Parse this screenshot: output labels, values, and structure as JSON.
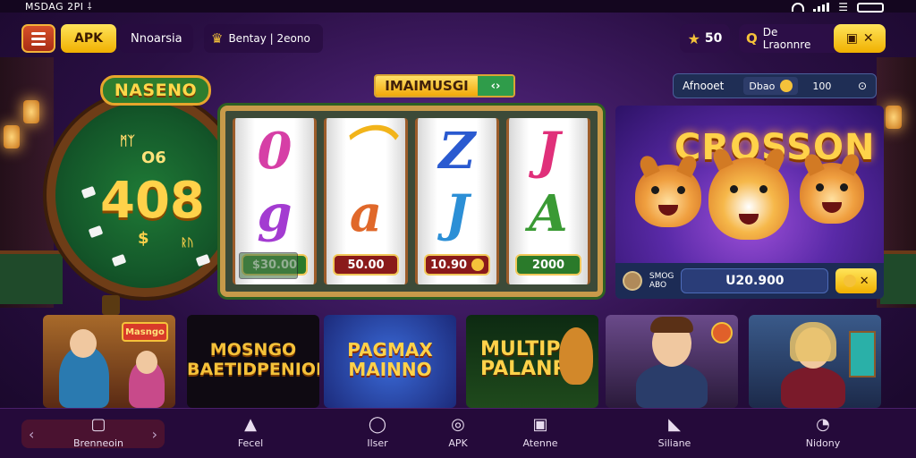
{
  "status_bar": {
    "time": "MSDAG 2PI ⸸"
  },
  "header": {
    "apk_label": "APK",
    "region_label": "Nnoarsia",
    "banner_label": "Bentay | 2eono",
    "stars_value": "50",
    "login_label": "De Lraonnre"
  },
  "wheel": {
    "sign": "NASENO",
    "code_top": "ᛗᛉ",
    "code_mid": "O6",
    "code_big": "408",
    "dollar": "$",
    "code_small": "ᚱᚢ"
  },
  "slot": {
    "header_label": "IMAIMUSGI",
    "toggle_label": "‹›",
    "reels": [
      {
        "top": "0",
        "bottom": "g",
        "top_color": "#d63fa6",
        "bottom_color": "#a33bd1",
        "payout": "$30.00",
        "payout_style": "green"
      },
      {
        "top": "⌒",
        "bottom": "a",
        "top_color": "#f2b41a",
        "bottom_color": "#e0682a",
        "payout": "50.00",
        "payout_style": "red"
      },
      {
        "top": "Z",
        "bottom": "J",
        "top_color": "#2a5ad0",
        "bottom_color": "#2c8fd6",
        "payout": "10.90",
        "payout_style": "red"
      },
      {
        "top": "J",
        "bottom": "A",
        "top_color": "#e0307a",
        "bottom_color": "#3a9a34",
        "payout": "2000",
        "payout_style": "green"
      }
    ]
  },
  "feature": {
    "bar_label": "Afnooet",
    "jackpot_label": "Dbao",
    "jackpot_amount": "100",
    "title": "CROSSON",
    "player_line1": "SMOG",
    "player_line2": "ABO",
    "amount": "U20.900"
  },
  "thumbnails": [
    {
      "title": "Masngo",
      "text": ""
    },
    {
      "title": "",
      "text": "MOSNGO BAETIDPENION"
    },
    {
      "title": "",
      "text": "PAGMAX MAINNO"
    },
    {
      "title": "",
      "text": "MULTIP PALANR"
    },
    {
      "title": "",
      "text": ""
    },
    {
      "title": "",
      "text": ""
    }
  ],
  "bottom_nav": [
    {
      "label": "Brenneoin",
      "icon": "square-face-icon"
    },
    {
      "label": "Fecel",
      "icon": "triangle-icon"
    },
    {
      "label": "Ilser",
      "icon": "ring-icon"
    },
    {
      "label": "APK",
      "icon": "circle-icon"
    },
    {
      "label": "Atenne",
      "icon": "box-icon"
    },
    {
      "label": "Siliane",
      "icon": "shoe-icon"
    },
    {
      "label": "Nidony",
      "icon": "chat-icon"
    }
  ]
}
